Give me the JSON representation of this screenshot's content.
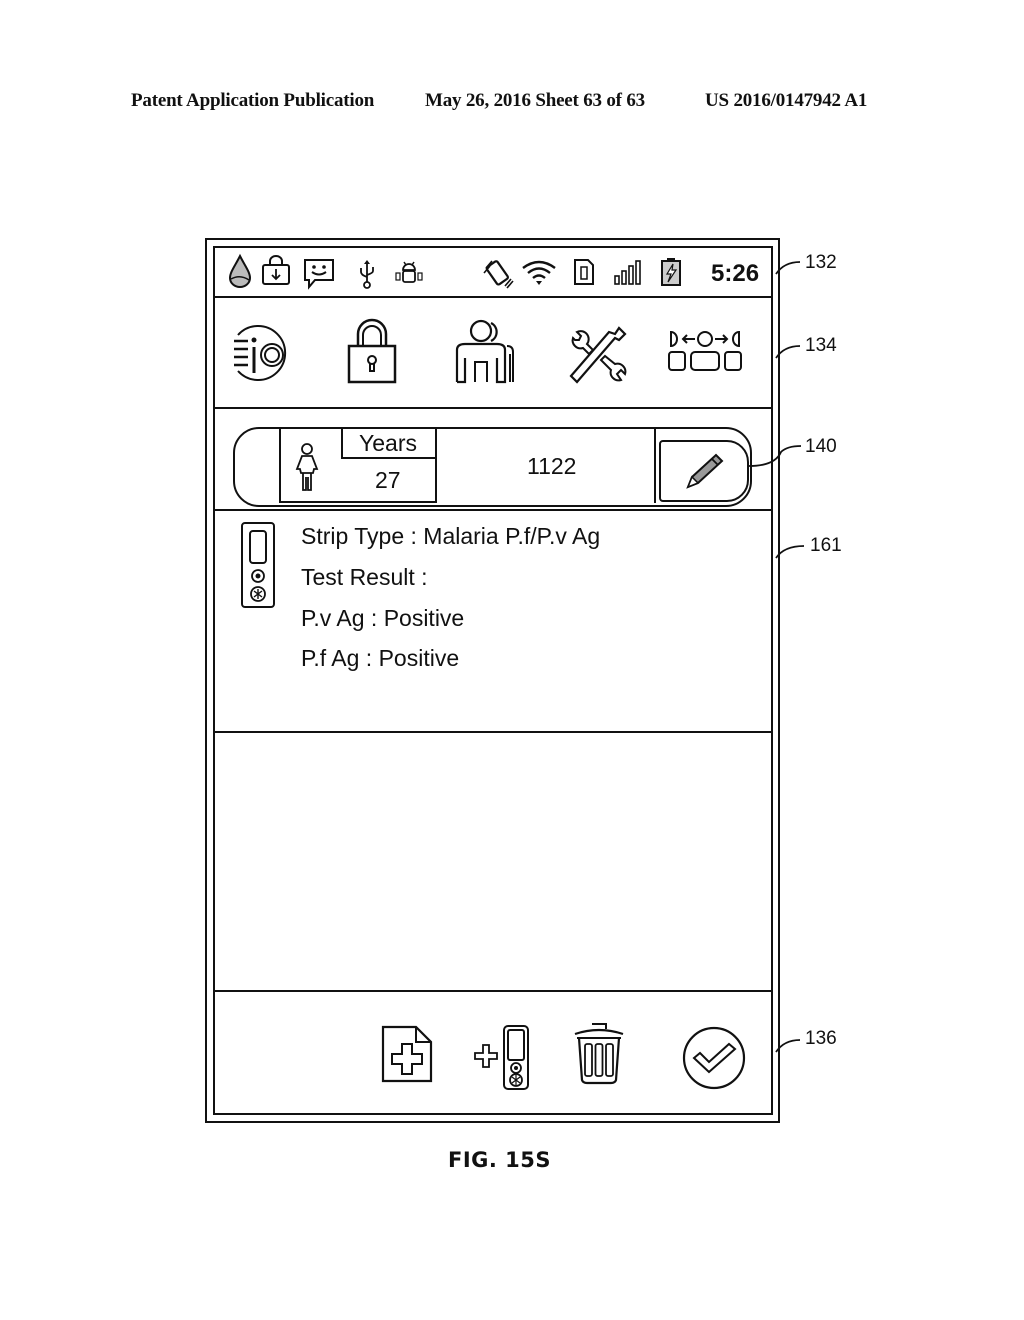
{
  "header": {
    "publication": "Patent Application Publication",
    "date_sheet": "May 26, 2016  Sheet 63 of 63",
    "patent_number": "US 2016/0147942 A1"
  },
  "figure": {
    "caption": "FIG. 15S",
    "reference_numerals": {
      "status_bar": "132",
      "toolbar": "134",
      "patient_bar": "140",
      "result_panel": "161",
      "bottom_toolbar": "136"
    }
  },
  "status_bar": {
    "left_icons": [
      "drop-icon",
      "download-bag-icon",
      "smiley-message-icon",
      "usb-icon",
      "android-debug-icon"
    ],
    "right_icons": [
      "vibrate-icon",
      "wifi-icon",
      "sim-card-icon",
      "signal-bars-icon",
      "battery-charging-icon"
    ],
    "time": "5:26"
  },
  "toolbar": {
    "items": [
      {
        "name": "app-logo",
        "icon": "io-logo-icon"
      },
      {
        "name": "lock",
        "icon": "padlock-icon"
      },
      {
        "name": "users",
        "icon": "users-icon"
      },
      {
        "name": "settings-tools",
        "icon": "wrench-screwdriver-icon"
      },
      {
        "name": "transfer",
        "icon": "data-transfer-icon"
      }
    ]
  },
  "patient_bar": {
    "gender_icon": "female-icon",
    "age_unit": "Years",
    "age": "27",
    "patient_id": "1122",
    "edit_icon": "pencil-icon"
  },
  "result": {
    "strip_icon": "test-strip-icon",
    "strip_type": "Strip Type : Malaria P.f/P.v Ag",
    "test_result_label": "Test Result :",
    "lines": [
      "P.v Ag : Positive",
      "P.f Ag : Positive"
    ]
  },
  "bottom_toolbar": {
    "items": [
      {
        "name": "new-document",
        "icon": "add-document-icon"
      },
      {
        "name": "add-strip",
        "icon": "add-strip-icon"
      },
      {
        "name": "delete",
        "icon": "trash-icon"
      },
      {
        "name": "confirm",
        "icon": "check-circle-icon"
      }
    ]
  }
}
